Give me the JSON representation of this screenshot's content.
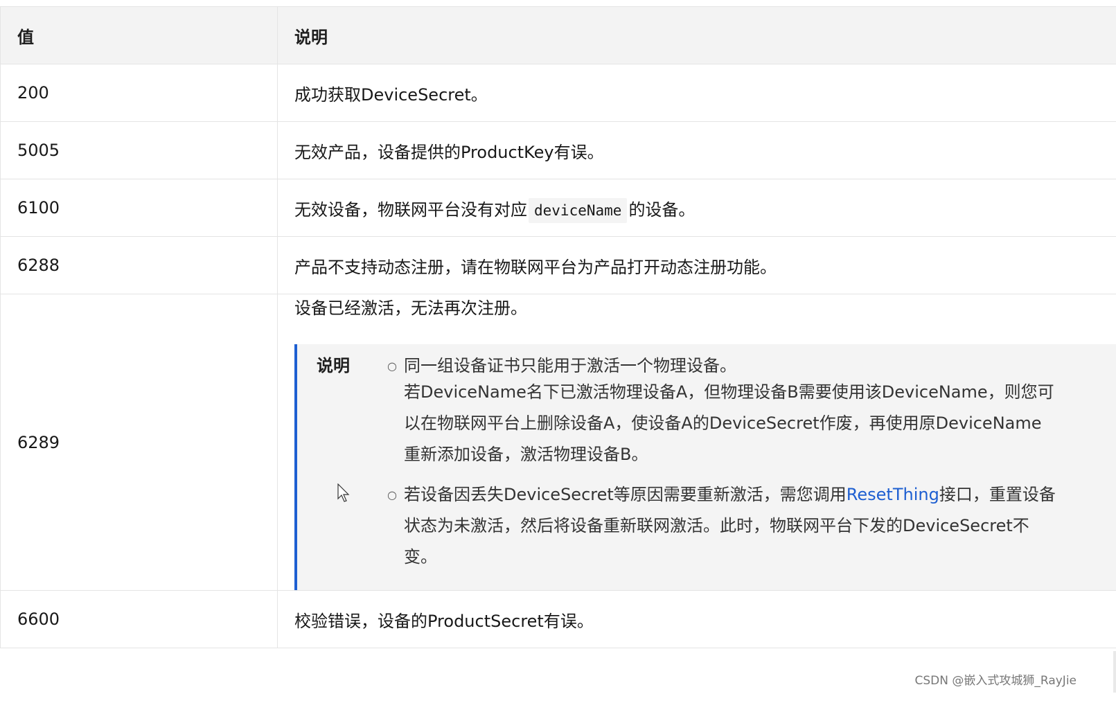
{
  "table": {
    "headers": {
      "value": "值",
      "description": "说明"
    },
    "rows": [
      {
        "value": "200",
        "description": "成功获取DeviceSecret。"
      },
      {
        "value": "5005",
        "description": "无效产品，设备提供的ProductKey有误。"
      },
      {
        "value": "6100",
        "description_before": "无效设备，物联网平台没有对应",
        "description_code": "deviceName",
        "description_after": "的设备。"
      },
      {
        "value": "6288",
        "description": "产品不支持动态注册，请在物联网平台为产品打开动态注册功能。"
      },
      {
        "value": "6289",
        "description": "设备已经激活，无法再次注册。",
        "note": {
          "title": "说明",
          "items": [
            {
              "line1": "同一组设备证书只能用于激活一个物理设备。",
              "rest": "若DeviceName名下已激活物理设备A，但物理设备B需要使用该DeviceName，则您可以在物联网平台上删除设备A，使设备A的DeviceSecret作废，再使用原DeviceName重新添加设备，激活物理设备B。"
            },
            {
              "before": "若设备因丢失DeviceSecret等原因需要重新激活，需您调用",
              "link": "ResetThing",
              "after": "接口，重置设备状态为未激活，然后将设备重新联网激活。此时，物联网平台下发的DeviceSecret不变。"
            }
          ]
        }
      },
      {
        "value": "6600",
        "description": "校验错误，设备的ProductSecret有误。"
      }
    ]
  },
  "watermark": "CSDN @嵌入式攻城狮_RayJie",
  "colors": {
    "accent": "#1e5fd1",
    "header_bg": "#f3f3f3",
    "note_bg": "#f4f4f4"
  }
}
